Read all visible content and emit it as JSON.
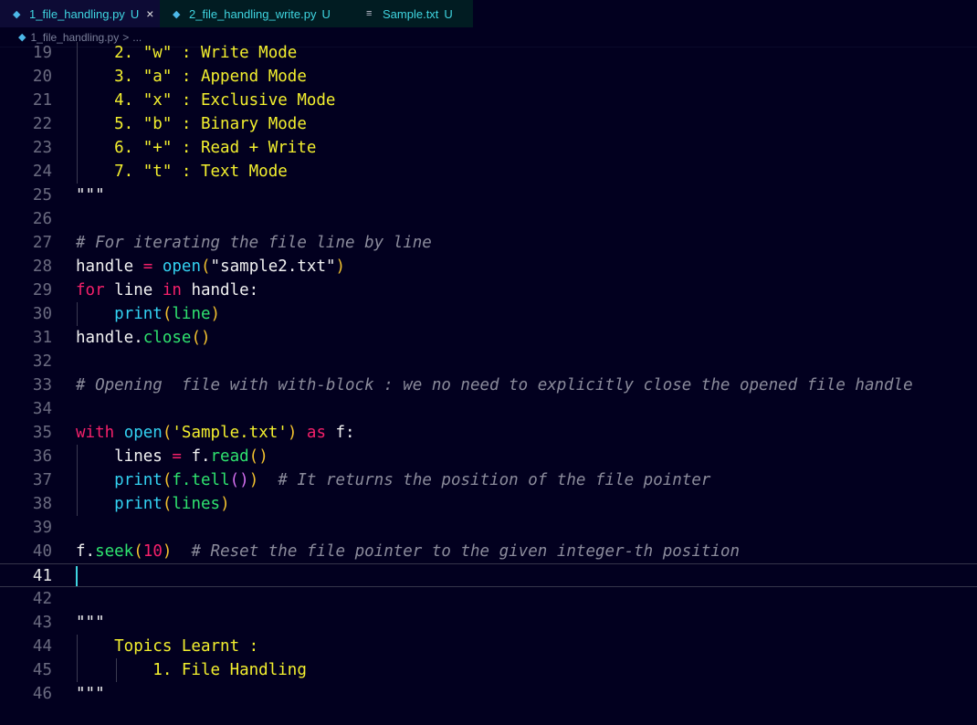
{
  "tabs": [
    {
      "label": "1_file_handling.py",
      "badge": "U",
      "close": "×",
      "icon": "python-icon"
    },
    {
      "label": "2_file_handling_write.py",
      "badge": "U",
      "icon": "python-icon"
    },
    {
      "label": "Sample.txt",
      "badge": "U",
      "icon": "text-file-icon"
    }
  ],
  "breadcrumb": {
    "file": "1_file_handling.py",
    "separator": ">",
    "more": "..."
  },
  "lines": [
    {
      "n": "19",
      "tokens": [
        {
          "t": "    2. \"w\" : Write Mode",
          "c": "str"
        }
      ]
    },
    {
      "n": "20",
      "tokens": [
        {
          "t": "    3. \"a\" : Append Mode",
          "c": "str"
        }
      ]
    },
    {
      "n": "21",
      "tokens": [
        {
          "t": "    4. \"x\" : Exclusive Mode",
          "c": "str"
        }
      ]
    },
    {
      "n": "22",
      "tokens": [
        {
          "t": "    5. \"b\" : Binary Mode",
          "c": "str"
        }
      ]
    },
    {
      "n": "23",
      "tokens": [
        {
          "t": "    6. \"+\" : Read + Write",
          "c": "str"
        }
      ]
    },
    {
      "n": "24",
      "tokens": [
        {
          "t": "    7. \"t\" : Text Mode",
          "c": "str"
        }
      ]
    },
    {
      "n": "25",
      "tokens": [
        {
          "t": "\"\"\"",
          "c": "def"
        }
      ]
    },
    {
      "n": "26",
      "tokens": []
    },
    {
      "n": "27",
      "tokens": [
        {
          "t": "# For iterating the file line by line",
          "c": "cmt"
        }
      ]
    },
    {
      "n": "28",
      "tokens": [
        {
          "t": "handle ",
          "c": "def"
        },
        {
          "t": "= ",
          "c": "op"
        },
        {
          "t": "open",
          "c": "fn"
        },
        {
          "t": "(",
          "c": "paren"
        },
        {
          "t": "\"sample2.txt\"",
          "c": "def"
        },
        {
          "t": ")",
          "c": "paren"
        }
      ]
    },
    {
      "n": "29",
      "tokens": [
        {
          "t": "for ",
          "c": "kw"
        },
        {
          "t": "line ",
          "c": "def"
        },
        {
          "t": "in ",
          "c": "kw"
        },
        {
          "t": "handle:",
          "c": "def"
        }
      ]
    },
    {
      "n": "30",
      "tokens": [
        {
          "t": "    ",
          "c": "def"
        },
        {
          "t": "print",
          "c": "fn"
        },
        {
          "t": "(",
          "c": "paren"
        },
        {
          "t": "line",
          "c": "var"
        },
        {
          "t": ")",
          "c": "paren"
        }
      ]
    },
    {
      "n": "31",
      "tokens": [
        {
          "t": "handle.",
          "c": "def"
        },
        {
          "t": "close",
          "c": "meth"
        },
        {
          "t": "()",
          "c": "paren"
        }
      ]
    },
    {
      "n": "32",
      "tokens": []
    },
    {
      "n": "33",
      "tokens": [
        {
          "t": "# Opening  file with with-block : we no need to explicitly close the opened file handle",
          "c": "cmt"
        }
      ]
    },
    {
      "n": "34",
      "tokens": []
    },
    {
      "n": "35",
      "tokens": [
        {
          "t": "with ",
          "c": "kw"
        },
        {
          "t": "open",
          "c": "fn"
        },
        {
          "t": "(",
          "c": "paren"
        },
        {
          "t": "'Sample.txt'",
          "c": "str"
        },
        {
          "t": ") ",
          "c": "paren"
        },
        {
          "t": "as ",
          "c": "kw"
        },
        {
          "t": "f:",
          "c": "def"
        }
      ]
    },
    {
      "n": "36",
      "tokens": [
        {
          "t": "    lines ",
          "c": "def"
        },
        {
          "t": "= ",
          "c": "op"
        },
        {
          "t": "f.",
          "c": "def"
        },
        {
          "t": "read",
          "c": "meth"
        },
        {
          "t": "()",
          "c": "paren"
        }
      ]
    },
    {
      "n": "37",
      "tokens": [
        {
          "t": "    ",
          "c": "def"
        },
        {
          "t": "print",
          "c": "fn"
        },
        {
          "t": "(",
          "c": "paren"
        },
        {
          "t": "f.",
          "c": "var"
        },
        {
          "t": "tell",
          "c": "meth"
        },
        {
          "t": "()",
          "c": "paren2"
        },
        {
          "t": ")",
          "c": "paren"
        },
        {
          "t": "  # It returns the position of the file pointer",
          "c": "cmt"
        }
      ]
    },
    {
      "n": "38",
      "tokens": [
        {
          "t": "    ",
          "c": "def"
        },
        {
          "t": "print",
          "c": "fn"
        },
        {
          "t": "(",
          "c": "paren"
        },
        {
          "t": "lines",
          "c": "var"
        },
        {
          "t": ")",
          "c": "paren"
        }
      ]
    },
    {
      "n": "39",
      "tokens": []
    },
    {
      "n": "40",
      "tokens": [
        {
          "t": "f.",
          "c": "def"
        },
        {
          "t": "seek",
          "c": "meth"
        },
        {
          "t": "(",
          "c": "paren"
        },
        {
          "t": "10",
          "c": "num"
        },
        {
          "t": ")",
          "c": "paren"
        },
        {
          "t": "  # Reset the file pointer to the given integer-th position",
          "c": "cmt"
        }
      ]
    },
    {
      "n": "41",
      "tokens": [],
      "current": true
    },
    {
      "n": "42",
      "tokens": []
    },
    {
      "n": "43",
      "tokens": [
        {
          "t": "\"\"\"",
          "c": "def"
        }
      ]
    },
    {
      "n": "44",
      "tokens": [
        {
          "t": "    Topics Learnt :",
          "c": "str"
        }
      ]
    },
    {
      "n": "45",
      "tokens": [
        {
          "t": "        1. File Handling",
          "c": "str"
        }
      ]
    },
    {
      "n": "46",
      "tokens": [
        {
          "t": "\"\"\"",
          "c": "def"
        }
      ]
    }
  ]
}
